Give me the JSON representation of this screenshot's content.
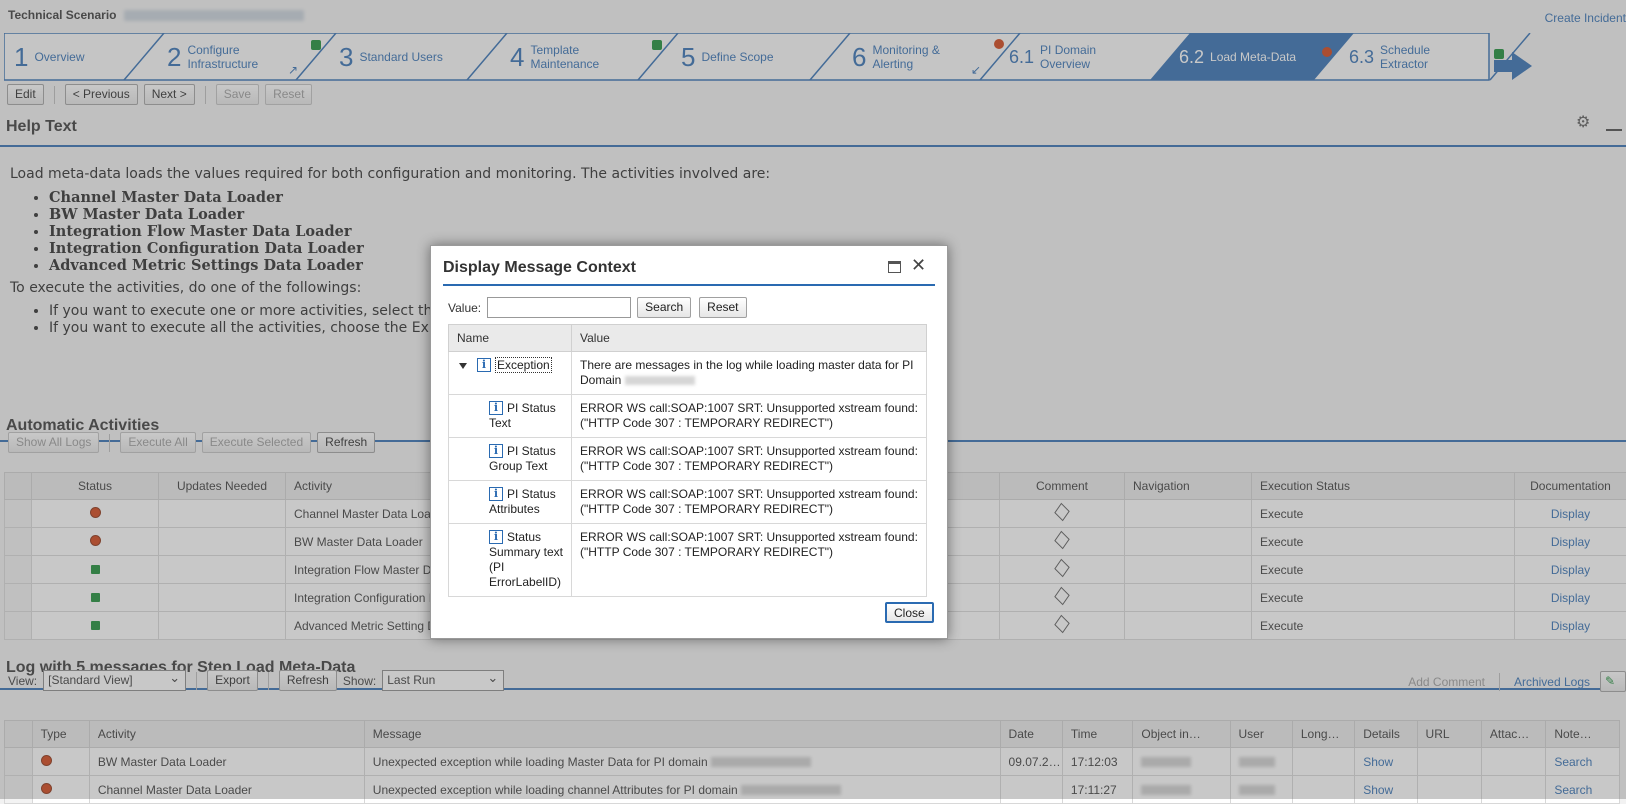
{
  "header": {
    "title": "Technical Scenario",
    "create_incident": "Create Incident"
  },
  "roadmap": [
    {
      "num": "1",
      "label": "Overview"
    },
    {
      "num": "2",
      "label": "Configure\nInfrastructure"
    },
    {
      "num": "3",
      "label": "Standard Users"
    },
    {
      "num": "4",
      "label": "Template\nMaintenance"
    },
    {
      "num": "5",
      "label": "Define Scope"
    },
    {
      "num": "6",
      "label": "Monitoring &\nAlerting"
    },
    {
      "num": "6.1",
      "label": "PI Domain\nOverview"
    },
    {
      "num": "6.2",
      "label": "Load Meta-Data"
    },
    {
      "num": "6.3",
      "label": "Schedule\nExtractor"
    }
  ],
  "toolbar": {
    "edit": "Edit",
    "previous": "< Previous",
    "next": "Next >",
    "save": "Save",
    "reset": "Reset"
  },
  "help": {
    "title": "Help Text",
    "intro": "Load meta-data loads the values required for both configuration and monitoring. The activities involved are:",
    "activities": [
      "Channel Master Data Loader",
      "BW Master Data Loader",
      "Integration Flow Master Data Loader",
      "Integration Configuration Data Loader",
      "Advanced Metric Settings Data Loader"
    ],
    "execute_intro": "To execute the activities, do one of the followings:",
    "options": [
      "If you want to execute one or more activities, select th",
      "If you want to execute all the activities, choose the Ex"
    ]
  },
  "automatic": {
    "title": "Automatic Activities",
    "buttons": {
      "show_all_logs": "Show All Logs",
      "execute_all": "Execute All",
      "execute_selected": "Execute Selected",
      "refresh": "Refresh"
    },
    "columns": [
      "Status",
      "Updates Needed",
      "Activity",
      "Comment",
      "Navigation",
      "Execution Status",
      "Documentation"
    ],
    "rows": [
      {
        "status": "red",
        "activity": "Channel Master Data Loa",
        "execution": "Execute",
        "doc": "Display"
      },
      {
        "status": "red",
        "activity": "BW Master Data Loader",
        "execution": "Execute",
        "doc": "Display"
      },
      {
        "status": "green",
        "activity": "Integration Flow Master D",
        "execution": "Execute",
        "doc": "Display"
      },
      {
        "status": "green",
        "activity": "Integration Configuration I",
        "execution": "Execute",
        "doc": "Display"
      },
      {
        "status": "green",
        "activity": "Advanced Metric Setting D",
        "execution": "Execute",
        "doc": "Display"
      }
    ]
  },
  "log": {
    "title": "Log with 5 messages for Step Load Meta-Data",
    "view_label": "View:",
    "view_value": "[Standard View]",
    "export": "Export",
    "refresh": "Refresh",
    "show_label": "Show:",
    "show_value": "Last Run",
    "add_comment": "Add Comment",
    "archived_logs": "Archived Logs",
    "columns": [
      "Type",
      "Activity",
      "Message",
      "Date",
      "Time",
      "Object in…",
      "User",
      "Long…",
      "Details",
      "URL",
      "Attac…",
      "Note…"
    ],
    "rows": [
      {
        "activity": "BW Master Data Loader",
        "message": "Unexpected exception while loading Master Data for PI domain",
        "date": "09.07.2…",
        "time": "17:12:03",
        "details": "Show",
        "note": "Search"
      },
      {
        "activity": "Channel Master Data Loader",
        "message": "Unexpected exception while loading channel Attributes for PI domain",
        "date": "",
        "time": "17:11:27",
        "details": "Show",
        "note": "Search"
      }
    ]
  },
  "dialog": {
    "title": "Display Message Context",
    "value_label": "Value:",
    "search": "Search",
    "reset": "Reset",
    "col_name": "Name",
    "col_value": "Value",
    "rows": [
      {
        "name": "Exception",
        "value": "There are messages in the log while loading master data for PI Domain"
      },
      {
        "name": "PI Status Text",
        "value": "ERROR WS call:SOAP:1007 SRT: Unsupported xstream found: (\"HTTP Code 307 : TEMPORARY REDIRECT\")"
      },
      {
        "name": "PI Status Group Text",
        "value": "ERROR WS call:SOAP:1007 SRT: Unsupported xstream found: (\"HTTP Code 307 : TEMPORARY REDIRECT\")"
      },
      {
        "name": "PI Status Attributes",
        "value": "ERROR WS call:SOAP:1007 SRT: Unsupported xstream found: (\"HTTP Code 307 : TEMPORARY REDIRECT\")"
      },
      {
        "name": "Status Summary text (PI ErrorLabelID)",
        "value": "ERROR WS call:SOAP:1007 SRT: Unsupported xstream found: (\"HTTP Code 307 : TEMPORARY REDIRECT\")"
      }
    ],
    "close": "Close"
  }
}
